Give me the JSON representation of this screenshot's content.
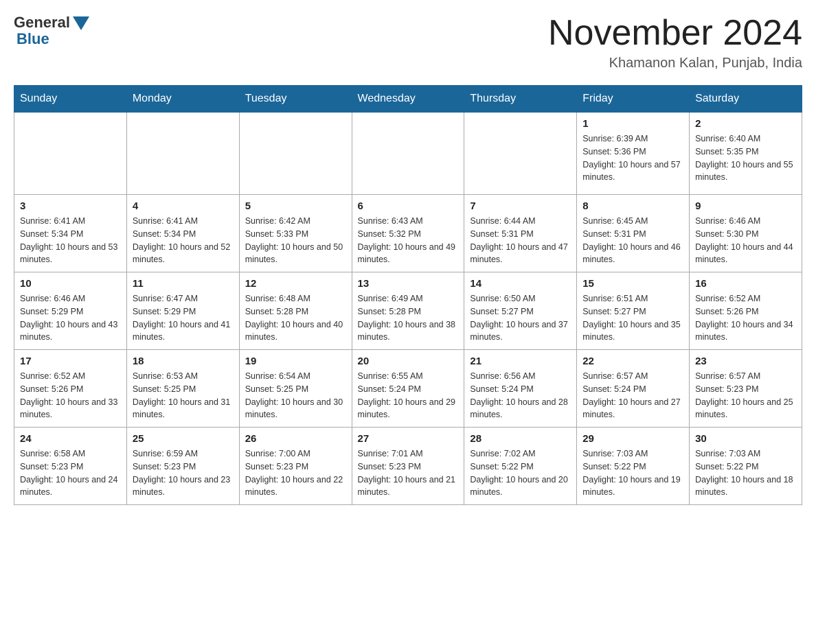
{
  "header": {
    "logo_general": "General",
    "logo_blue": "Blue",
    "month_title": "November 2024",
    "location": "Khamanon Kalan, Punjab, India"
  },
  "weekdays": [
    "Sunday",
    "Monday",
    "Tuesday",
    "Wednesday",
    "Thursday",
    "Friday",
    "Saturday"
  ],
  "weeks": [
    [
      {
        "day": "",
        "sunrise": "",
        "sunset": "",
        "daylight": ""
      },
      {
        "day": "",
        "sunrise": "",
        "sunset": "",
        "daylight": ""
      },
      {
        "day": "",
        "sunrise": "",
        "sunset": "",
        "daylight": ""
      },
      {
        "day": "",
        "sunrise": "",
        "sunset": "",
        "daylight": ""
      },
      {
        "day": "",
        "sunrise": "",
        "sunset": "",
        "daylight": ""
      },
      {
        "day": "1",
        "sunrise": "Sunrise: 6:39 AM",
        "sunset": "Sunset: 5:36 PM",
        "daylight": "Daylight: 10 hours and 57 minutes."
      },
      {
        "day": "2",
        "sunrise": "Sunrise: 6:40 AM",
        "sunset": "Sunset: 5:35 PM",
        "daylight": "Daylight: 10 hours and 55 minutes."
      }
    ],
    [
      {
        "day": "3",
        "sunrise": "Sunrise: 6:41 AM",
        "sunset": "Sunset: 5:34 PM",
        "daylight": "Daylight: 10 hours and 53 minutes."
      },
      {
        "day": "4",
        "sunrise": "Sunrise: 6:41 AM",
        "sunset": "Sunset: 5:34 PM",
        "daylight": "Daylight: 10 hours and 52 minutes."
      },
      {
        "day": "5",
        "sunrise": "Sunrise: 6:42 AM",
        "sunset": "Sunset: 5:33 PM",
        "daylight": "Daylight: 10 hours and 50 minutes."
      },
      {
        "day": "6",
        "sunrise": "Sunrise: 6:43 AM",
        "sunset": "Sunset: 5:32 PM",
        "daylight": "Daylight: 10 hours and 49 minutes."
      },
      {
        "day": "7",
        "sunrise": "Sunrise: 6:44 AM",
        "sunset": "Sunset: 5:31 PM",
        "daylight": "Daylight: 10 hours and 47 minutes."
      },
      {
        "day": "8",
        "sunrise": "Sunrise: 6:45 AM",
        "sunset": "Sunset: 5:31 PM",
        "daylight": "Daylight: 10 hours and 46 minutes."
      },
      {
        "day": "9",
        "sunrise": "Sunrise: 6:46 AM",
        "sunset": "Sunset: 5:30 PM",
        "daylight": "Daylight: 10 hours and 44 minutes."
      }
    ],
    [
      {
        "day": "10",
        "sunrise": "Sunrise: 6:46 AM",
        "sunset": "Sunset: 5:29 PM",
        "daylight": "Daylight: 10 hours and 43 minutes."
      },
      {
        "day": "11",
        "sunrise": "Sunrise: 6:47 AM",
        "sunset": "Sunset: 5:29 PM",
        "daylight": "Daylight: 10 hours and 41 minutes."
      },
      {
        "day": "12",
        "sunrise": "Sunrise: 6:48 AM",
        "sunset": "Sunset: 5:28 PM",
        "daylight": "Daylight: 10 hours and 40 minutes."
      },
      {
        "day": "13",
        "sunrise": "Sunrise: 6:49 AM",
        "sunset": "Sunset: 5:28 PM",
        "daylight": "Daylight: 10 hours and 38 minutes."
      },
      {
        "day": "14",
        "sunrise": "Sunrise: 6:50 AM",
        "sunset": "Sunset: 5:27 PM",
        "daylight": "Daylight: 10 hours and 37 minutes."
      },
      {
        "day": "15",
        "sunrise": "Sunrise: 6:51 AM",
        "sunset": "Sunset: 5:27 PM",
        "daylight": "Daylight: 10 hours and 35 minutes."
      },
      {
        "day": "16",
        "sunrise": "Sunrise: 6:52 AM",
        "sunset": "Sunset: 5:26 PM",
        "daylight": "Daylight: 10 hours and 34 minutes."
      }
    ],
    [
      {
        "day": "17",
        "sunrise": "Sunrise: 6:52 AM",
        "sunset": "Sunset: 5:26 PM",
        "daylight": "Daylight: 10 hours and 33 minutes."
      },
      {
        "day": "18",
        "sunrise": "Sunrise: 6:53 AM",
        "sunset": "Sunset: 5:25 PM",
        "daylight": "Daylight: 10 hours and 31 minutes."
      },
      {
        "day": "19",
        "sunrise": "Sunrise: 6:54 AM",
        "sunset": "Sunset: 5:25 PM",
        "daylight": "Daylight: 10 hours and 30 minutes."
      },
      {
        "day": "20",
        "sunrise": "Sunrise: 6:55 AM",
        "sunset": "Sunset: 5:24 PM",
        "daylight": "Daylight: 10 hours and 29 minutes."
      },
      {
        "day": "21",
        "sunrise": "Sunrise: 6:56 AM",
        "sunset": "Sunset: 5:24 PM",
        "daylight": "Daylight: 10 hours and 28 minutes."
      },
      {
        "day": "22",
        "sunrise": "Sunrise: 6:57 AM",
        "sunset": "Sunset: 5:24 PM",
        "daylight": "Daylight: 10 hours and 27 minutes."
      },
      {
        "day": "23",
        "sunrise": "Sunrise: 6:57 AM",
        "sunset": "Sunset: 5:23 PM",
        "daylight": "Daylight: 10 hours and 25 minutes."
      }
    ],
    [
      {
        "day": "24",
        "sunrise": "Sunrise: 6:58 AM",
        "sunset": "Sunset: 5:23 PM",
        "daylight": "Daylight: 10 hours and 24 minutes."
      },
      {
        "day": "25",
        "sunrise": "Sunrise: 6:59 AM",
        "sunset": "Sunset: 5:23 PM",
        "daylight": "Daylight: 10 hours and 23 minutes."
      },
      {
        "day": "26",
        "sunrise": "Sunrise: 7:00 AM",
        "sunset": "Sunset: 5:23 PM",
        "daylight": "Daylight: 10 hours and 22 minutes."
      },
      {
        "day": "27",
        "sunrise": "Sunrise: 7:01 AM",
        "sunset": "Sunset: 5:23 PM",
        "daylight": "Daylight: 10 hours and 21 minutes."
      },
      {
        "day": "28",
        "sunrise": "Sunrise: 7:02 AM",
        "sunset": "Sunset: 5:22 PM",
        "daylight": "Daylight: 10 hours and 20 minutes."
      },
      {
        "day": "29",
        "sunrise": "Sunrise: 7:03 AM",
        "sunset": "Sunset: 5:22 PM",
        "daylight": "Daylight: 10 hours and 19 minutes."
      },
      {
        "day": "30",
        "sunrise": "Sunrise: 7:03 AM",
        "sunset": "Sunset: 5:22 PM",
        "daylight": "Daylight: 10 hours and 18 minutes."
      }
    ]
  ]
}
